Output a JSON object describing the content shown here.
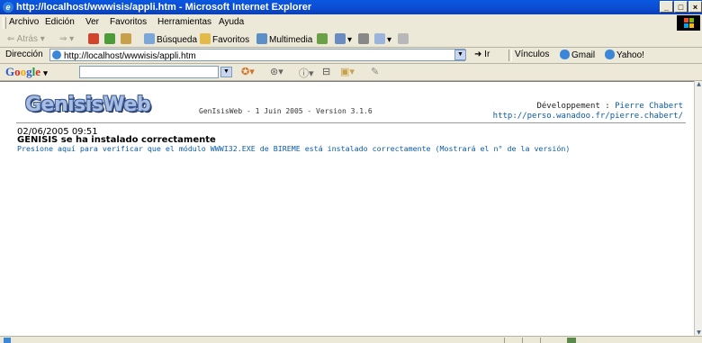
{
  "window": {
    "title": "http://localhost/wwwisis/appli.htm - Microsoft Internet Explorer",
    "buttons": {
      "minimize": "_",
      "maximize": "□",
      "close": "×"
    }
  },
  "menu": [
    "Archivo",
    "Edición",
    "Ver",
    "Favoritos",
    "Herramientas",
    "Ayuda"
  ],
  "toolbar": {
    "back": "Atrás",
    "search": "Búsqueda",
    "favorites": "Favoritos",
    "multimedia": "Multimedia"
  },
  "address": {
    "label": "Dirección",
    "url": "http://localhost/wwwisis/appli.htm",
    "go": "Ir",
    "links_label": "Vínculos",
    "links": [
      "Gmail",
      "Yahoo!"
    ]
  },
  "google": {
    "value": ""
  },
  "page": {
    "logo": "GenisisWeb",
    "version": "GenIsisWeb - 1 Juin 2005 - Version 3.1.6",
    "dev_label": "Développement :",
    "dev_name": "Pierre Chabert",
    "dev_url": "http://perso.wanadoo.fr/pierre.chabert/",
    "datetime": "02/06/2005 09:51",
    "installed": "GENISIS se ha instalado correctamente",
    "verify_link": "Presione aquí para verificar que el módulo WWWI32.EXE de BIREME está instalado correctamente (Mostrará el n° de la versión)"
  },
  "colors": {
    "link": "#0b5ba8",
    "titlebar": "#0b4bd1",
    "logo_fill": "#a9bde0"
  }
}
